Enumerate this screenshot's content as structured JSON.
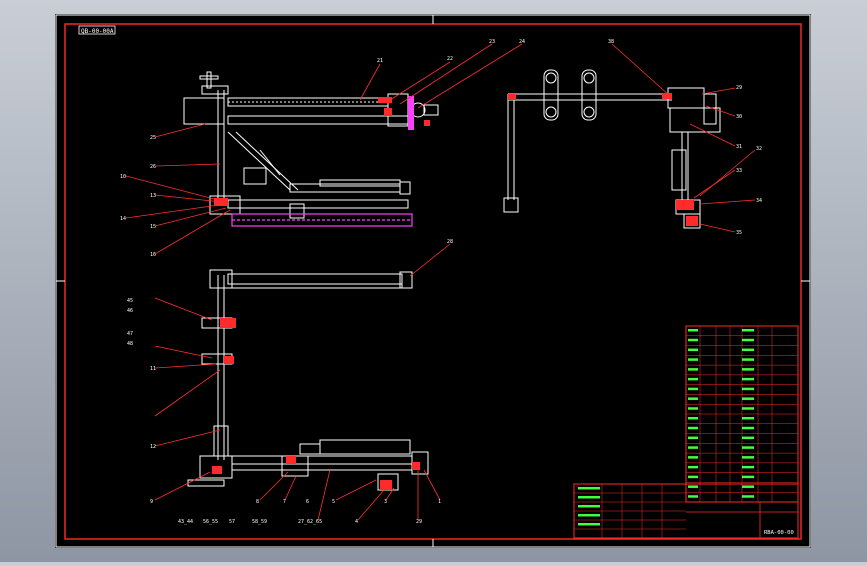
{
  "drawing": {
    "title_tag": "QB-00-00A",
    "drawing_no": "RBA-00-00",
    "callouts": {
      "upper": [
        "21",
        "22",
        "23",
        "24",
        "25",
        "26",
        "10",
        "13",
        "14",
        "15",
        "16",
        "17",
        "18",
        "19",
        "20",
        "28"
      ],
      "right": [
        "38",
        "29",
        "30",
        "31",
        "32",
        "33",
        "34",
        "35",
        "36",
        "37"
      ],
      "lower_left": [
        "45",
        "46",
        "47",
        "48",
        "11",
        "12"
      ],
      "lower_bottom": [
        "9",
        "43_44",
        "56_55",
        "57",
        "8",
        "58_59",
        "7",
        "60_61",
        "6",
        "27_62_65",
        "5",
        "4",
        "3",
        "2",
        "1",
        "29"
      ]
    },
    "title_block": {
      "rows": 18
    }
  },
  "colors": {
    "background": "#000000",
    "frame": "#ff2a2a",
    "line": "#ffffff",
    "leader": "#ff3030",
    "magenta": "#ff40ff",
    "green_text": "#40ff40",
    "yellow_text": "#ffff40"
  }
}
